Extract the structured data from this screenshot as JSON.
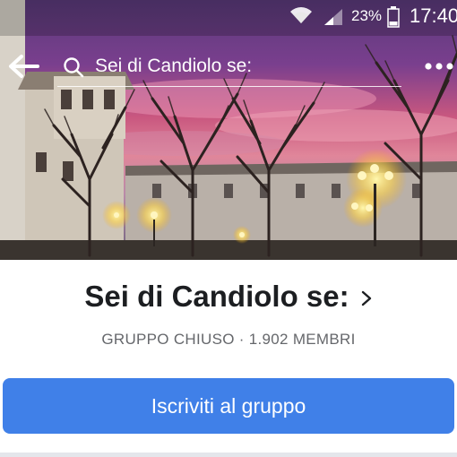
{
  "status_bar": {
    "battery_percent": "23%",
    "time": "17:40",
    "wifi_icon": "wifi-icon",
    "signal_icon": "cell-signal-icon",
    "battery_icon": "battery-icon"
  },
  "nav": {
    "back_icon": "arrow-left-icon",
    "search_icon": "search-icon",
    "search_text": "Sei di Candiolo se:",
    "more_icon": "more-horizontal-icon"
  },
  "group": {
    "title": "Sei di Candiolo se:",
    "meta": "GRUPPO CHIUSO · 1.902 MEMBRI",
    "chevron_icon": "chevron-right-icon"
  },
  "actions": {
    "join_label": "Iscriviti al gruppo"
  },
  "colors": {
    "join_button": "#4080e8",
    "title_text": "#1c1e21",
    "meta_text": "#65676b"
  }
}
